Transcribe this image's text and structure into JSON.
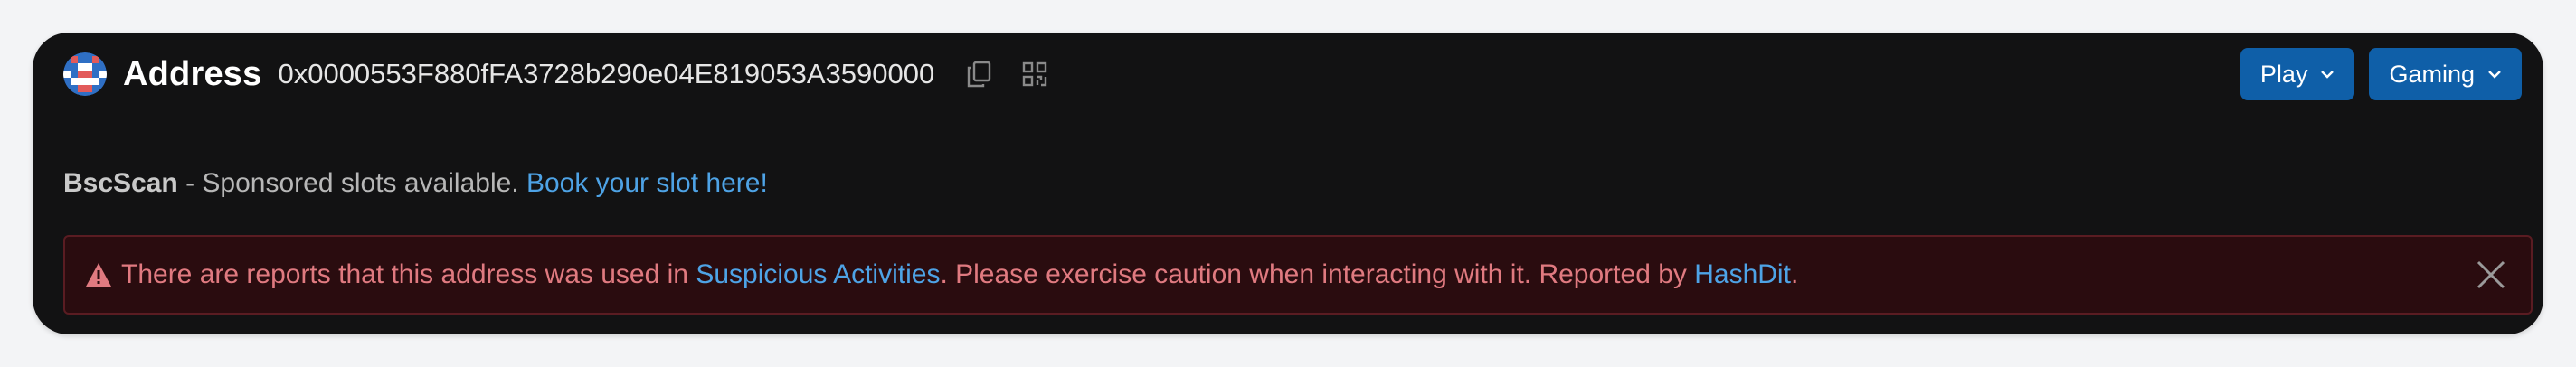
{
  "header": {
    "title": "Address",
    "address": "0x0000553F880fFA3728b290e04E819053A3590000",
    "icons": [
      "copy-icon",
      "qr-code-icon"
    ],
    "buttons": [
      {
        "label": "Play"
      },
      {
        "label": "Gaming"
      }
    ]
  },
  "sponsor": {
    "brand": "BscScan",
    "text": " - Sponsored slots available. ",
    "link": "Book your slot here!"
  },
  "alert": {
    "prefix": "There are reports that this address was used in ",
    "link1": "Suspicious Activities",
    "middle": ". Please exercise caution when interacting with it. Reported by ",
    "link2": "HashDit",
    "suffix": "."
  },
  "colors": {
    "panel_bg": "#121213",
    "button_bg": "#0f5fa8",
    "link": "#4ea3e6",
    "alert_bg": "#2a0c0f",
    "alert_text": "#e07a80"
  }
}
